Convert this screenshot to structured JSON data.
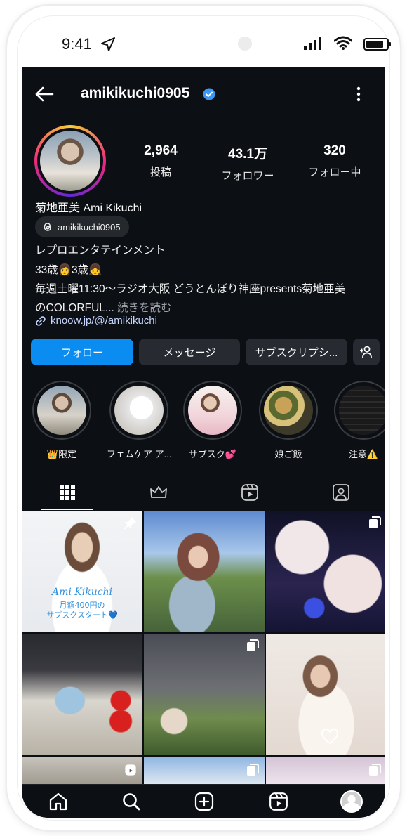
{
  "status_bar": {
    "time": "9:41"
  },
  "profile": {
    "username": "amikikuchi0905",
    "stats": [
      {
        "value": "2,964",
        "label": "投稿"
      },
      {
        "value": "43.1万",
        "label": "フォロワー"
      },
      {
        "value": "320",
        "label": "フォロー中"
      }
    ],
    "full_name": "菊地亜美 Ami Kikuchi",
    "threads_handle": "amikikuchi0905",
    "bio_lines": [
      "レプロエンタテインメント",
      "33歳👩3歳👧",
      "毎週土曜11:30〜ラジオ大阪 どうとんぼり神座presents菊地亜美",
      "のCOLORFUL..."
    ],
    "bio_more": " 続きを読む",
    "link": "knoow.jp/@/amikikuchi",
    "accent_color": "#0a8cf0",
    "verified_color": "#3b97f3"
  },
  "actions": {
    "follow": "フォロー",
    "message": "メッセージ",
    "subscribe": "サブスクリプシ..."
  },
  "highlights": [
    {
      "label": "👑限定"
    },
    {
      "label": "フェムケア ア..."
    },
    {
      "label": "サブスク💕"
    },
    {
      "label": "娘ご飯"
    },
    {
      "label": "注意⚠️"
    }
  ],
  "tabs": [
    "grid-icon",
    "crown-icon",
    "reels-icon",
    "tagged-icon"
  ],
  "posts": [
    {
      "overlay_title": "Ami Kikuchi",
      "overlay_line1": "月額400円の",
      "overlay_line2": "サブスクスタート💙",
      "badge": "pin-icon"
    },
    {
      "badge": ""
    },
    {
      "badge": "carousel-icon"
    },
    {
      "badge": ""
    },
    {
      "badge": "carousel-icon"
    },
    {
      "badge": "heart-icon"
    }
  ],
  "bottom_nav": [
    "home-icon",
    "search-icon",
    "create-icon",
    "reels-icon",
    "profile-avatar"
  ]
}
